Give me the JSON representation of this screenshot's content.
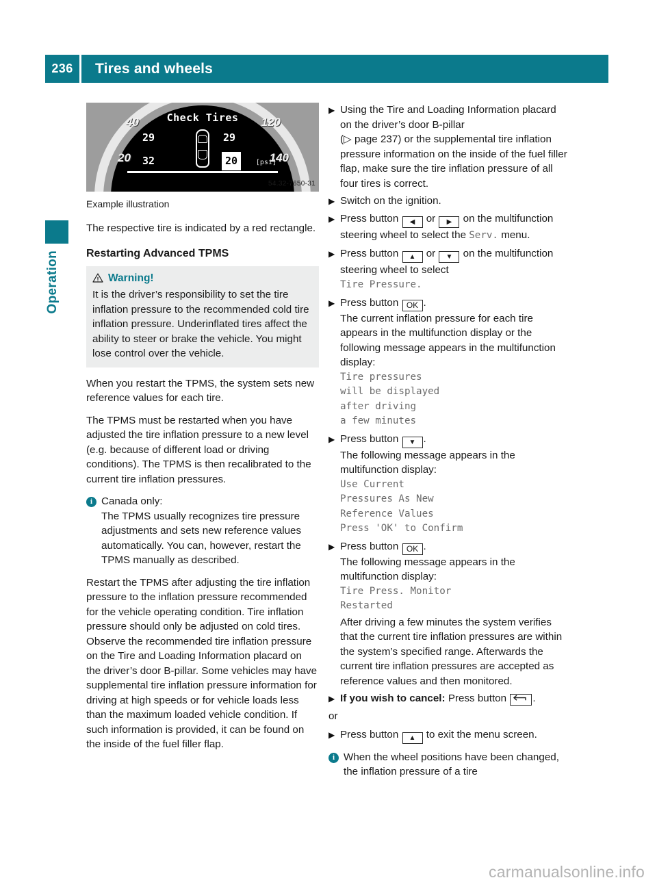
{
  "header": {
    "page_number": "236",
    "title": "Tires and wheels"
  },
  "sidebar": {
    "vertical_label": "Operation"
  },
  "figure": {
    "display_header": "Check Tires",
    "front_left": "29",
    "front_right": "29",
    "rear_left": "32",
    "rear_right": "20",
    "unit": "[psi]",
    "scale_left_upper": "40",
    "scale_left_lower": "20",
    "scale_right_upper": "120",
    "scale_right_lower": "140",
    "figure_code": "54.32-7650-31",
    "caption": "Example illustration"
  },
  "left_column": {
    "intro": "The respective tire is indicated by a red rectangle.",
    "subheading": "Restarting Advanced TPMS",
    "warning": {
      "label": "Warning!",
      "body": "It is the driver’s responsibility to set the tire inflation pressure to the recommended cold tire inflation pressure. Underinflated tires affect the ability to steer or brake the vehicle. You might lose control over the vehicle."
    },
    "para_restart": "When you restart the TPMS, the system sets new reference values for each tire.",
    "para_must": "The TPMS must be restarted when you have adjusted the tire inflation pressure to a new level (e.g. because of different load or driving conditions). The TPMS is then recalibrated to the current tire inflation pressures.",
    "note_canada_title": "Canada only:",
    "note_canada_body": "The TPMS usually recognizes tire pressure adjustments and sets new reference values automatically. You can, however, restart the TPMS manually as described.",
    "para_restart_after": "Restart the TPMS after adjusting the tire inflation pressure to the inflation pressure recommended for the vehicle operating condition. Tire inflation pressure should only be adjusted on cold tires. Observe the recommended tire inflation pressure on the Tire and Loading Information placard on the driver’s door B-pillar. Some vehicles may have supplemental tire inflation pressure information for driving at high speeds or for vehicle loads less than the maximum loaded vehicle condition. If such information is provided, it can be found on the inside of the fuel filler flap."
  },
  "right_column": {
    "step1_a": "Using the Tire and Loading Information placard on the driver’s door B-pillar",
    "step1_ref_open": "(",
    "step1_ref_text": " page 237",
    "step1_ref_close": ")",
    "step1_b": " or the supplemental tire inflation pressure information on the inside of the fuel filler flap, make sure the tire inflation pressure of all four tires is correct.",
    "step2": "Switch on the ignition.",
    "step3_pre": "Press button ",
    "step3_or": " or ",
    "step3_post": " on the multifunction steering wheel to select the ",
    "step3_menu": "Serv.",
    "step3_tail": " menu.",
    "step4_pre": "Press button ",
    "step4_or": " or ",
    "step4_post": " on the multifunction steering wheel to select ",
    "step4_menu": "Tire Pressure.",
    "step5_pre": "Press button ",
    "step5_key": "OK",
    "step5_post": ".",
    "step5_body": "The current inflation pressure for each tire appears in the multifunction display or the following message appears in the multifunction display:",
    "msg1": [
      "Tire pressures",
      "will be displayed",
      "after driving",
      "a few minutes"
    ],
    "step6_pre": "Press button ",
    "step6_post": ".",
    "step6_body": "The following message appears in the multifunction display:",
    "msg2": [
      "Use Current",
      "Pressures As New",
      "Reference Values",
      "Press 'OK' to Confirm"
    ],
    "step7_pre": "Press button ",
    "step7_key": "OK",
    "step7_post": ".",
    "step7_body": "The following message appears in the multifunction display:",
    "msg3": [
      "Tire Press. Monitor",
      "Restarted"
    ],
    "step7_after": "After driving a few minutes the system verifies that the current tire inflation pressures are within the system’s specified range. Afterwards the current tire inflation pressures are accepted as reference values and then monitored.",
    "step8_lead": "If you wish to cancel:",
    "step8_pre": " Press button ",
    "step8_post": ".",
    "or_text": "or",
    "step9_pre": "Press button ",
    "step9_post": " to exit the menu screen.",
    "note_wheel": "When the wheel positions have been changed, the inflation pressure of a tire"
  },
  "icons": {
    "bullet": "▶",
    "ref_arrow": "▷",
    "left_arrow": "◀",
    "right_arrow": "▶",
    "up_arrow": "▲",
    "down_arrow": "▼",
    "ok_label": "OK",
    "info_glyph": "i"
  },
  "footer": {
    "watermark": "carmanualsonline.info"
  },
  "colors": {
    "accent": "#0b7a8c",
    "warning_bg": "#eceded",
    "display_text": "#6a6a6a",
    "watermark": "#b3b3b3"
  }
}
